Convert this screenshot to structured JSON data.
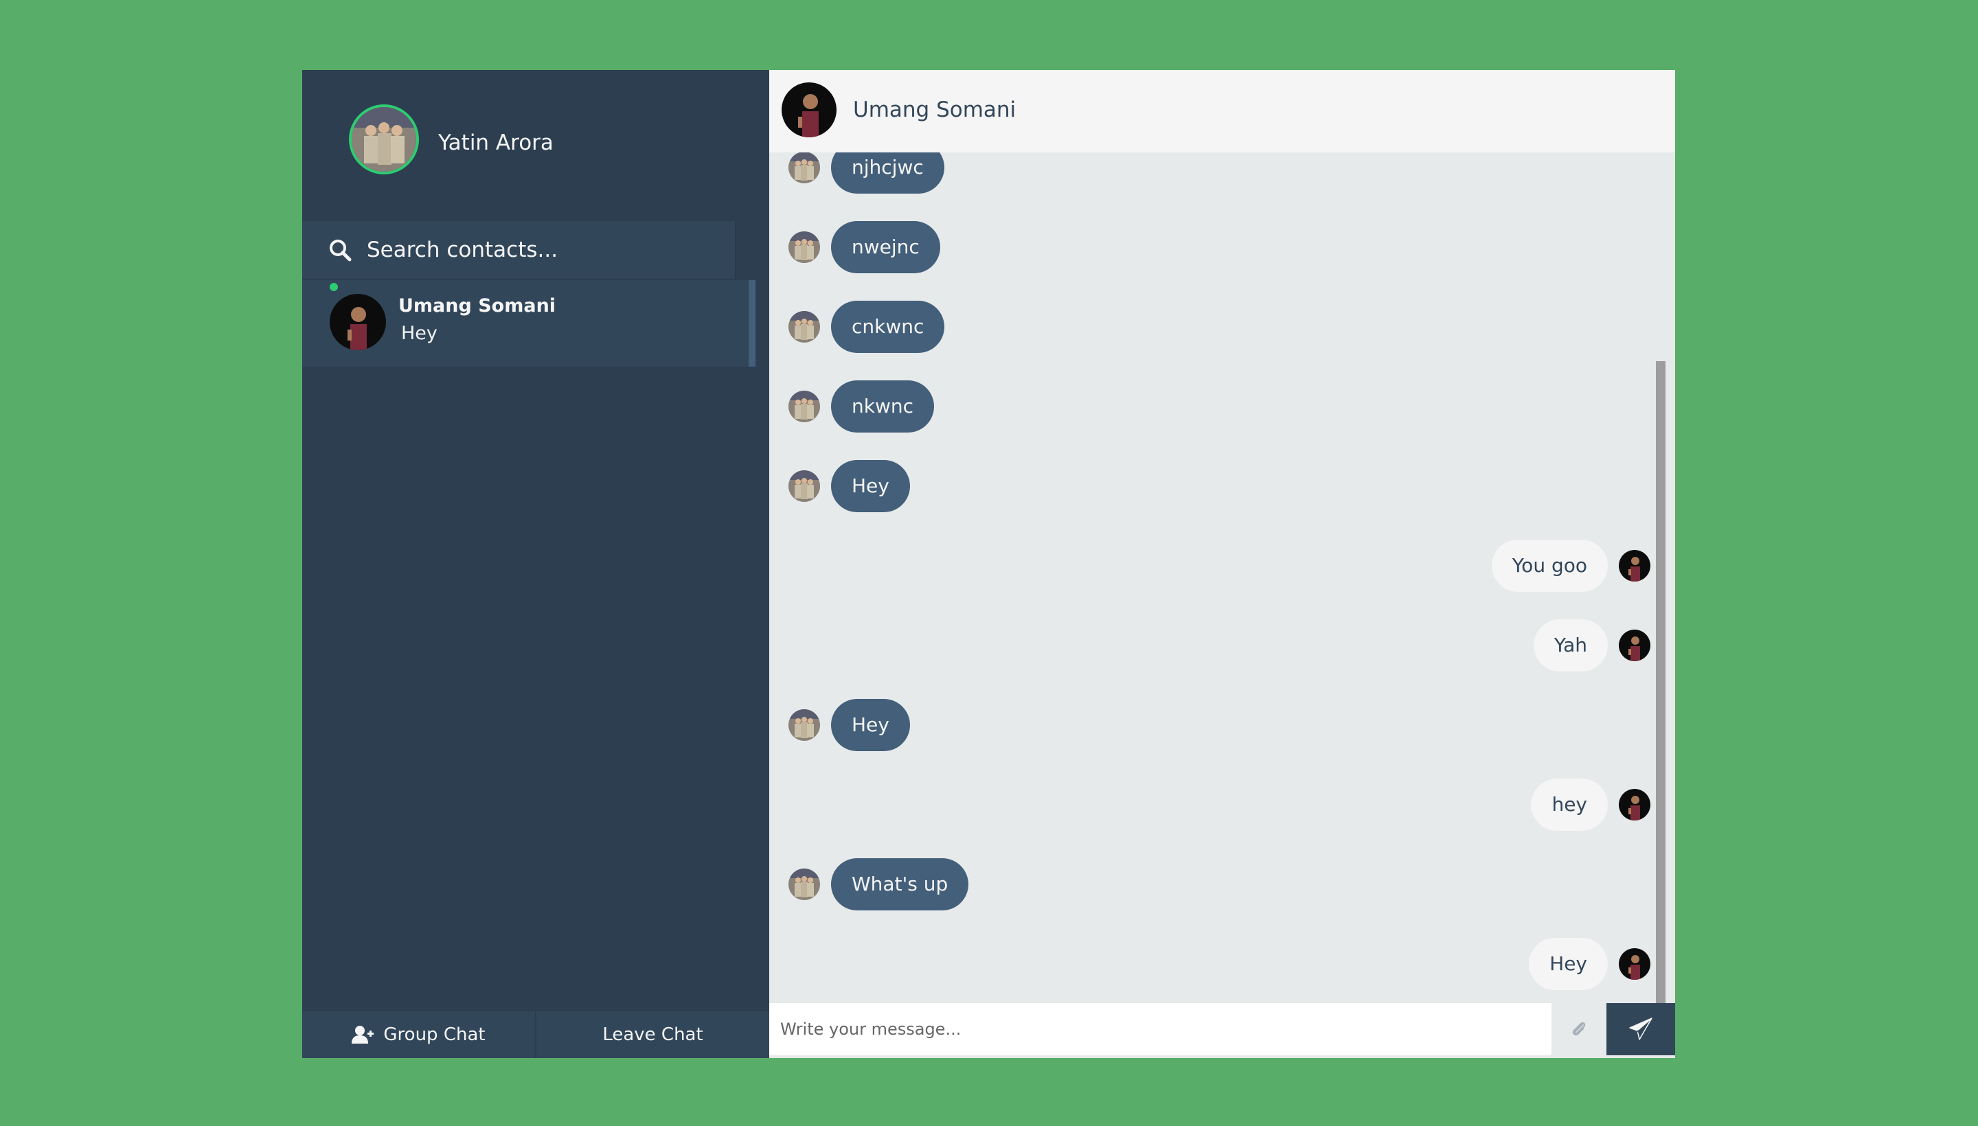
{
  "profile": {
    "name": "Yatin Arora"
  },
  "search": {
    "placeholder": "Search contacts..."
  },
  "contacts": [
    {
      "name": "Umang Somani",
      "preview": "Hey",
      "status": "online"
    }
  ],
  "bottom_bar": {
    "group_chat_label": "Group Chat",
    "leave_chat_label": "Leave Chat"
  },
  "chat": {
    "contact_name": "Umang Somani",
    "messages": [
      {
        "type": "sent",
        "text": "njhcjwc"
      },
      {
        "type": "sent",
        "text": "nwejnc"
      },
      {
        "type": "sent",
        "text": "cnkwnc"
      },
      {
        "type": "sent",
        "text": "nkwnc"
      },
      {
        "type": "sent",
        "text": "Hey"
      },
      {
        "type": "replies",
        "text": "You goo"
      },
      {
        "type": "replies",
        "text": "Yah"
      },
      {
        "type": "sent",
        "text": "Hey"
      },
      {
        "type": "replies",
        "text": "hey"
      },
      {
        "type": "sent",
        "text": "What's up"
      },
      {
        "type": "replies",
        "text": "Hey"
      }
    ],
    "input_placeholder": "Write your message..."
  },
  "icons": {
    "search": "search-icon",
    "group_add": "user-plus-icon",
    "attach": "paperclip-icon",
    "send": "paper-plane-icon"
  },
  "colors": {
    "background": "#58ad69",
    "sidebar": "#2c3e50",
    "sidebar_light": "#32465a",
    "sent_bubble": "#435f7a",
    "reply_bubble": "#f5f5f5",
    "chat_bg": "#e6eaea",
    "online": "#2ecc71"
  }
}
